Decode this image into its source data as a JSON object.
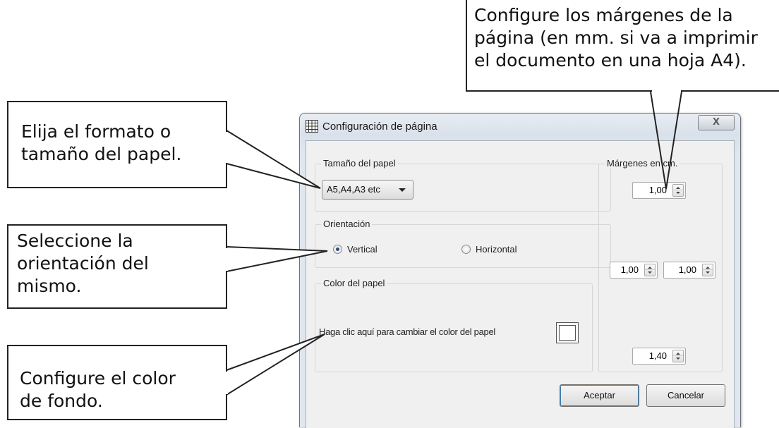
{
  "callouts": {
    "margins": "Configure los márgenes de la\npágina (en mm. si va a imprimir\nel documento en una hoja A4).",
    "paper_size": "Elija el formato o\ntamaño del papel.",
    "orientation": "Seleccione la\norientación del\nmismo.",
    "bg_color": "Configure el color\nde fondo."
  },
  "dialog": {
    "title": "Configuración de página",
    "close_label": "X",
    "paper_size": {
      "group_label": "Tamaño del papel",
      "selected": "A5,A4,A3 etc"
    },
    "orientation": {
      "group_label": "Orientación",
      "options": [
        "Vertical",
        "Horizontal"
      ],
      "selected": "Vertical"
    },
    "paper_color": {
      "group_label": "Color del papel",
      "instruction": "Haga clic aquí para cambiar el color del papel",
      "swatch_color": "#ffffff"
    },
    "margins": {
      "group_label": "Márgenes en cm.",
      "top": "1,00",
      "left": "1,00",
      "right": "1,00",
      "bottom": "1,40"
    },
    "buttons": {
      "ok": "Aceptar",
      "cancel": "Cancelar"
    }
  }
}
